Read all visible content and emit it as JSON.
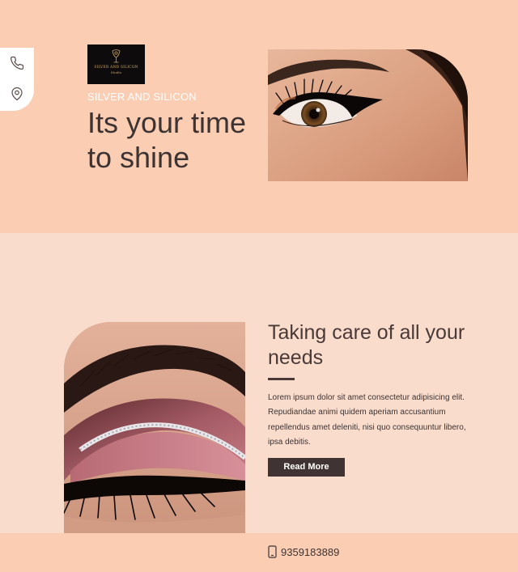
{
  "contact_dock": {
    "icons": [
      "phone-icon",
      "location-pin-icon"
    ]
  },
  "logo": {
    "brand_text": "SILVER AND SILICON",
    "script_text": "Studio"
  },
  "hero": {
    "tagline": "SILVER AND SILICON",
    "title": "Its your time to shine",
    "image": "eye-makeup-winged-eyeliner-photo"
  },
  "services": {
    "title": "Taking care of all your needs",
    "body": "Lorem ipsum dolor sit amet consectetur adipisicing elit. Repudiandae animi quidem aperiam accusantium repellendus amet deleniti, nisi quo consequuntur libero, ipsa debitis.",
    "button_label": "Read More",
    "image": "pink-eyeshadow-glitter-liner-photo"
  },
  "footer": {
    "phone": "9359183889",
    "phone_icon": "mobile-phone-icon"
  },
  "colors": {
    "hero_bg": "#fbcdb3",
    "page_bg": "#f9dccc",
    "text_dark": "#3d3332",
    "button_bg": "#3f3333",
    "logo_bg": "#0d0b0b",
    "logo_gold": "#c9a36a"
  }
}
